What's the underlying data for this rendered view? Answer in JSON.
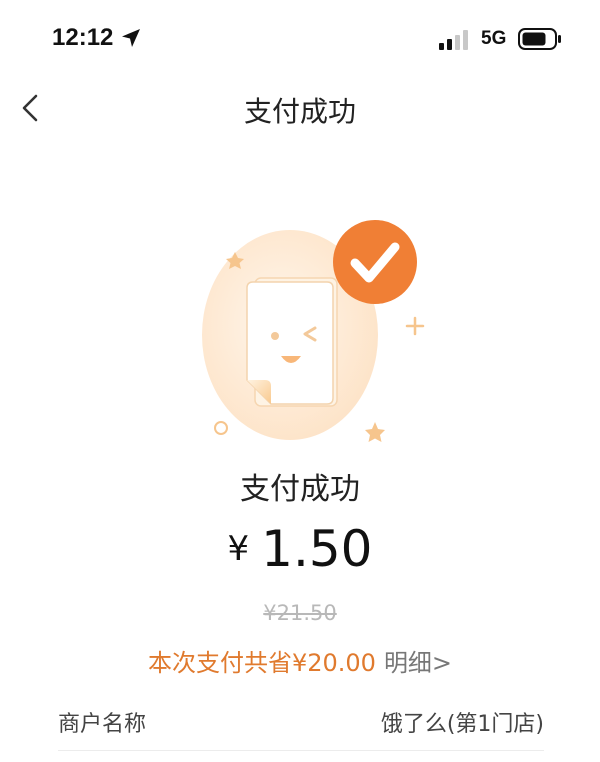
{
  "status_bar": {
    "time": "12:12",
    "network": "5G",
    "location_icon": "location-arrow-icon",
    "signal_icon": "signal-bars-icon",
    "battery_icon": "battery-icon"
  },
  "nav": {
    "title": "支付成功",
    "back_icon": "chevron-left-icon"
  },
  "illustration": {
    "icon": "payment-success-receipt-icon",
    "badge_icon": "checkmark-icon"
  },
  "payment": {
    "status": "支付成功",
    "currency": "¥",
    "amount": "1.50",
    "original_price": "¥21.50",
    "savings_text": "本次支付共省¥20.00",
    "details_link": "明细>"
  },
  "merchant": {
    "label": "商户名称",
    "value": "饿了么(第1门店)"
  },
  "colors": {
    "accent": "#f07f35",
    "savings": "#e07a2e",
    "strikethrough": "#b8b8b8"
  }
}
